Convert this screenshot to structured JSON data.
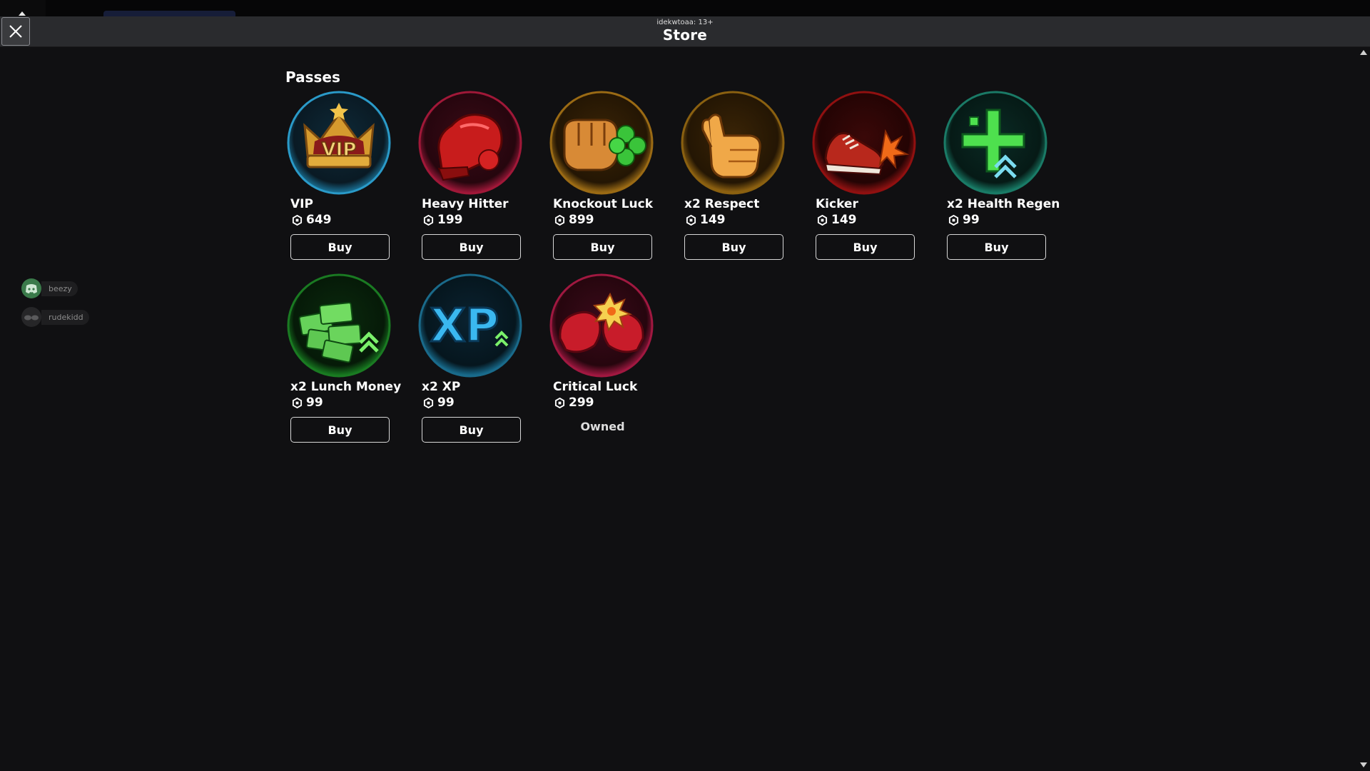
{
  "window": {
    "subtitle": "idekwtoaa: 13+",
    "title": "Store"
  },
  "section": {
    "title": "Passes"
  },
  "passes": [
    {
      "name": "VIP",
      "price": "649",
      "action": "Buy",
      "icon": "vip-crown-icon",
      "color": "#1a6a8a"
    },
    {
      "name": "Heavy Hitter",
      "price": "199",
      "action": "Buy",
      "icon": "boxing-glove-icon",
      "color": "#8a1830"
    },
    {
      "name": "Knockout Luck",
      "price": "899",
      "action": "Buy",
      "icon": "fist-clover-icon",
      "color": "#8a5a10"
    },
    {
      "name": "x2 Respect",
      "price": "149",
      "action": "Buy",
      "icon": "thumbs-up-icon",
      "color": "#8a5a10"
    },
    {
      "name": "Kicker",
      "price": "149",
      "action": "Buy",
      "icon": "sneaker-icon",
      "color": "#8a1010"
    },
    {
      "name": "x2 Health Regen",
      "price": "99",
      "action": "Buy",
      "icon": "health-cross-icon",
      "color": "#1a6a5a"
    },
    {
      "name": "x2 Lunch Money",
      "price": "99",
      "action": "Buy",
      "icon": "money-stack-icon",
      "color": "#1a7a20"
    },
    {
      "name": "x2 XP",
      "price": "99",
      "action": "Buy",
      "icon": "xp-icon",
      "color": "#1a5a7a"
    },
    {
      "name": "Critical Luck",
      "price": "299",
      "action": "Owned",
      "icon": "critical-gloves-icon",
      "color": "#8a1838"
    }
  ],
  "players": [
    {
      "name": "beezy",
      "icon": "discord-avatar-icon"
    },
    {
      "name": "rudekidd",
      "icon": "avatar-icon"
    }
  ]
}
